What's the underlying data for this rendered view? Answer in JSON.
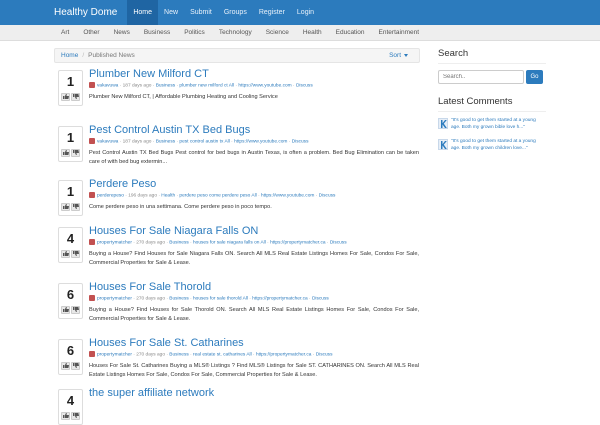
{
  "brand": "Healthy Dome",
  "topnav": [
    "Home",
    "New",
    "Submit",
    "Groups",
    "Register",
    "Login"
  ],
  "categories": [
    "Art",
    "Other",
    "News",
    "Business",
    "Politics",
    "Technology",
    "Science",
    "Health",
    "Education",
    "Entertainment"
  ],
  "breadcrumb": {
    "home": "Home",
    "current": "Published News",
    "sort_label": "Sort"
  },
  "stories": [
    {
      "votes": "1",
      "title": "Plumber New Milford CT",
      "meta": {
        "user": "vakavuwa",
        "age": "187 days ago",
        "category": "Business",
        "tags": "plumber new milford ct All",
        "link": "https://www.youtube.com",
        "discuss": "Discuss"
      },
      "desc": "Plumber New Milford CT, | Affordable Plumbing Heating and Cooling Service"
    },
    {
      "votes": "1",
      "title": "Pest Control Austin TX Bed Bugs",
      "meta": {
        "user": "vakavuwa",
        "age": "187 days ago",
        "category": "Business",
        "tags": "pest control austin tx All",
        "link": "https://www.youtube.com",
        "discuss": "Discuss"
      },
      "desc": "Pest Control Austin TX Bed Bugs Pest control for bed bugs in Austin Texas, is often a problem. Bed Bug Elimination can be taken care of with bed bug extermin..."
    },
    {
      "votes": "1",
      "title": "Perdere Peso",
      "meta": {
        "user": "perderepeso",
        "age": "196 days ago",
        "category": "Health",
        "tags": "perdere peso come perdere peso All",
        "link": "https://www.youtube.com",
        "discuss": "Discuss"
      },
      "desc": "Come perdere peso in una settimana. Come perdere peso in poco tempo."
    },
    {
      "votes": "4",
      "title": "Houses For Sale Niagara Falls ON",
      "meta": {
        "user": "propertymatcher",
        "age": "270 days ago",
        "category": "Business",
        "tags": "houses for sale niagara falls on All",
        "link": "https://propertymatcher.ca",
        "discuss": "Discuss"
      },
      "desc": "Buying a House? Find Houses for Sale Niagara Falls ON. Search All MLS Real Estate Listings Homes For Sale, Condos For Sale, Commercial Properties for Sale & Lease."
    },
    {
      "votes": "6",
      "title": "Houses For Sale Thorold",
      "meta": {
        "user": "propertymatcher",
        "age": "270 days ago",
        "category": "Business",
        "tags": "houses for sale thorold All",
        "link": "https://propertymatcher.ca",
        "discuss": "Discuss"
      },
      "desc": "Buying a House? Find Houses for Sale Thorold ON. Search All MLS Real Estate Listings Homes For Sale, Condos For Sale, Commercial Properties for Sale & Lease."
    },
    {
      "votes": "6",
      "title": "Houses For Sale St. Catharines",
      "meta": {
        "user": "propertymatcher",
        "age": "270 days ago",
        "category": "Business",
        "tags": "real estate st. catharines All",
        "link": "https://propertymatcher.ca",
        "discuss": "Discuss"
      },
      "desc": "Houses For Sale St. Catharines Buying a MLS® Listings ? Find MLS® Listings for Sale ST. CATHARINES ON. Search All MLS Real Estate Listings Homes For Sale, Condos For Sale, Commercial Properties for Sale & Lease."
    },
    {
      "votes": "4",
      "title": "the super affiliate network",
      "meta": {
        "user": "",
        "age": "",
        "category": "",
        "tags": "",
        "link": "",
        "discuss": ""
      },
      "desc": ""
    }
  ],
  "sidebar": {
    "search_title": "Search",
    "search_placeholder": "Search..",
    "search_button": "Go",
    "comments_title": "Latest Comments",
    "comments": [
      {
        "text": "\"It's good to get them started at a young age. Both my grown bible love h...\""
      },
      {
        "text": "\"It's good to get them started at a young age. Both my grown children love...\""
      }
    ]
  },
  "colors": {
    "accent": "#2c7bbd",
    "nav_active": "#1f65a3",
    "catbar": "#eeeeee"
  }
}
